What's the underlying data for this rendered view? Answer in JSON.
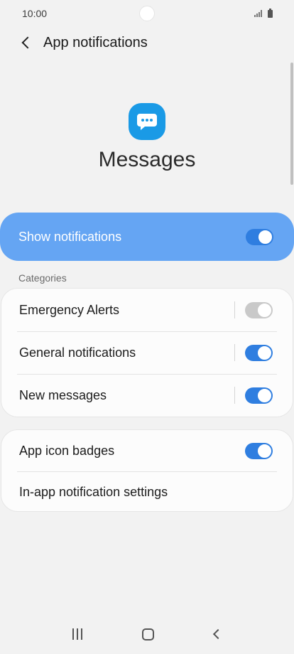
{
  "status_bar": {
    "time": "10:00"
  },
  "header": {
    "title": "App notifications",
    "back_icon": "chevron-left-icon"
  },
  "app": {
    "name": "Messages",
    "icon": "messages-chat-bubble-icon",
    "icon_color": "#1a9ae6"
  },
  "show_notifications": {
    "label": "Show notifications",
    "enabled": true,
    "bg_color": "#65a5f3"
  },
  "categories": {
    "label": "Categories",
    "items": [
      {
        "label": "Emergency Alerts",
        "enabled": true,
        "disabled": true
      },
      {
        "label": "General notifications",
        "enabled": true,
        "disabled": false
      },
      {
        "label": "New messages",
        "enabled": true,
        "disabled": false
      }
    ]
  },
  "badges": {
    "app_icon_badges": {
      "label": "App icon badges",
      "enabled": true
    },
    "in_app_settings": {
      "label": "In-app notification settings"
    }
  },
  "nav_bar": {
    "recent_icon": "recent-apps-icon",
    "home_icon": "home-icon",
    "back_icon": "back-icon"
  },
  "accent_color": "#2f7ee0"
}
